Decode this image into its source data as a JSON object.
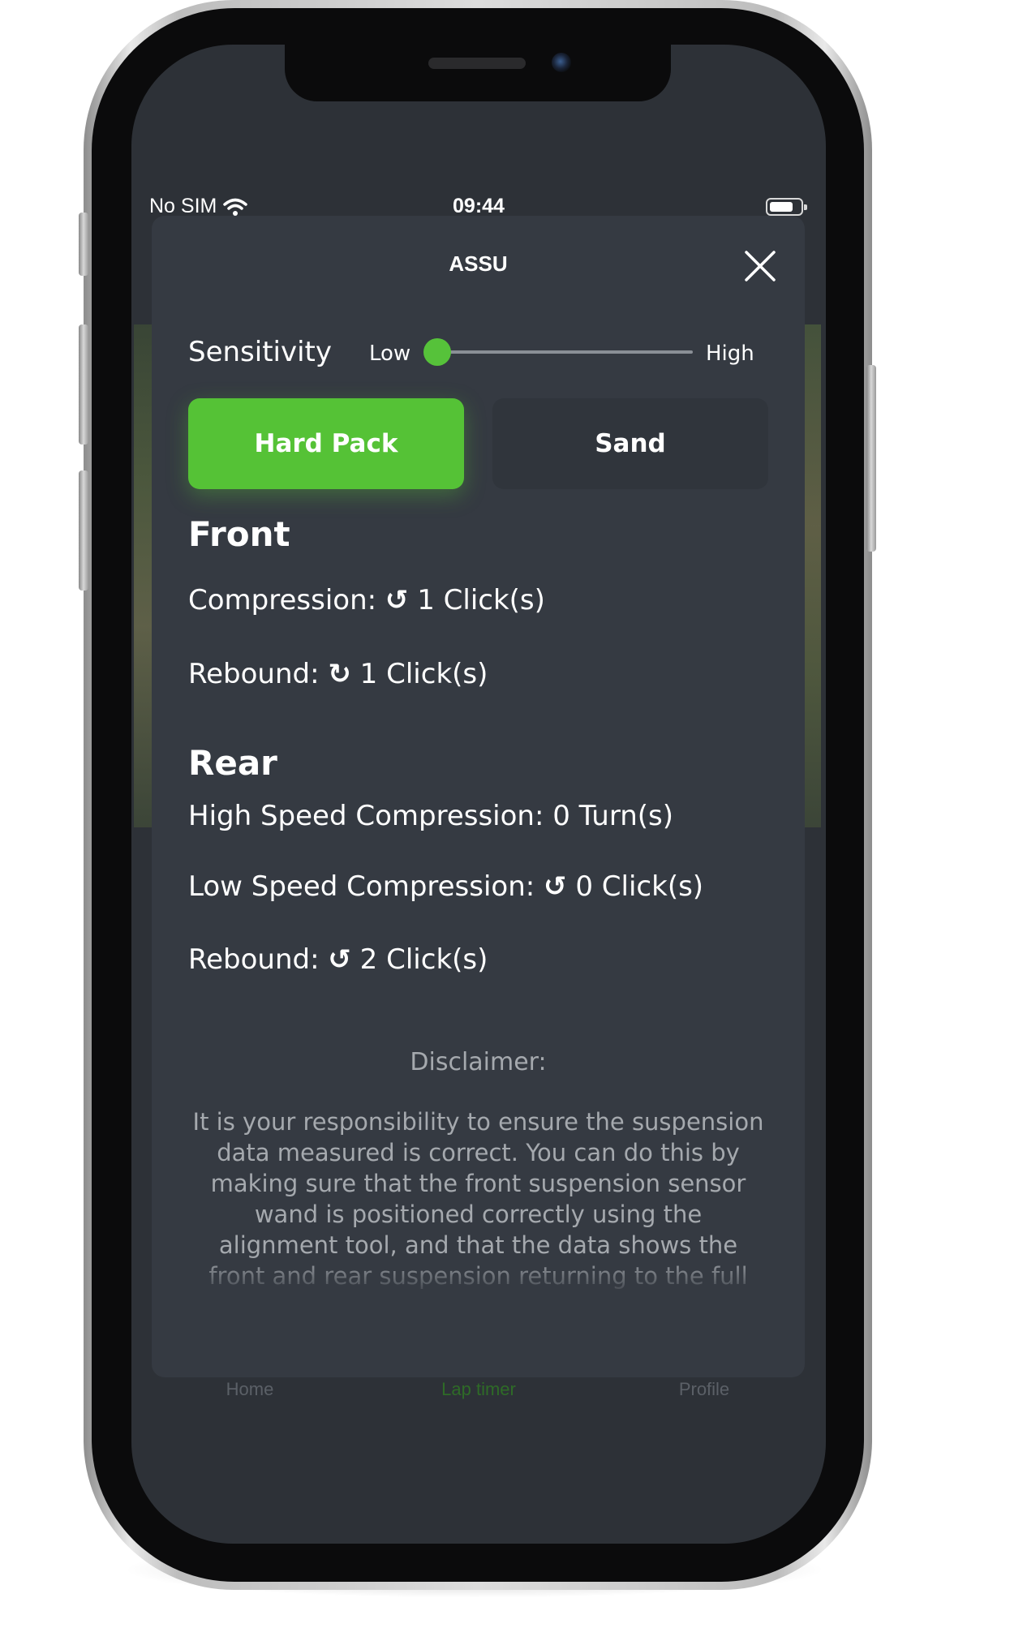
{
  "status_bar": {
    "carrier": "No SIM",
    "time": "09:44"
  },
  "modal": {
    "title": "ASSU",
    "close_icon": "close-icon"
  },
  "sensitivity": {
    "label": "Sensitivity",
    "low_label": "Low",
    "high_label": "High",
    "value": 0
  },
  "terrain": {
    "options": [
      "Hard Pack",
      "Sand"
    ],
    "selected": "Hard Pack",
    "accent_color": "#55c236"
  },
  "front": {
    "heading": "Front",
    "compression": {
      "label": "Compression:",
      "icon": "↺",
      "value": "1 Click(s)"
    },
    "rebound": {
      "label": "Rebound:",
      "icon": "↻",
      "value": "1 Click(s)"
    }
  },
  "rear": {
    "heading": "Rear",
    "high_speed_compression": {
      "label": "High Speed Compression:",
      "value": "0 Turn(s)"
    },
    "low_speed_compression": {
      "label": "Low Speed Compression:",
      "icon": "↺",
      "value": "0 Click(s)"
    },
    "rebound": {
      "label": "Rebound:",
      "icon": "↺",
      "value": "2 Click(s)"
    }
  },
  "disclaimer": {
    "title": "Disclaimer:",
    "body": "It is your responsibility to ensure the suspension data measured is correct. You can do this by making sure that the front suspension sensor wand is positioned correctly using the alignment tool, and that the data shows the front and rear suspension returning to the full extended"
  },
  "tab_bar": {
    "tabs": [
      "Home",
      "Lap timer",
      "Profile"
    ],
    "active": "Lap timer"
  }
}
